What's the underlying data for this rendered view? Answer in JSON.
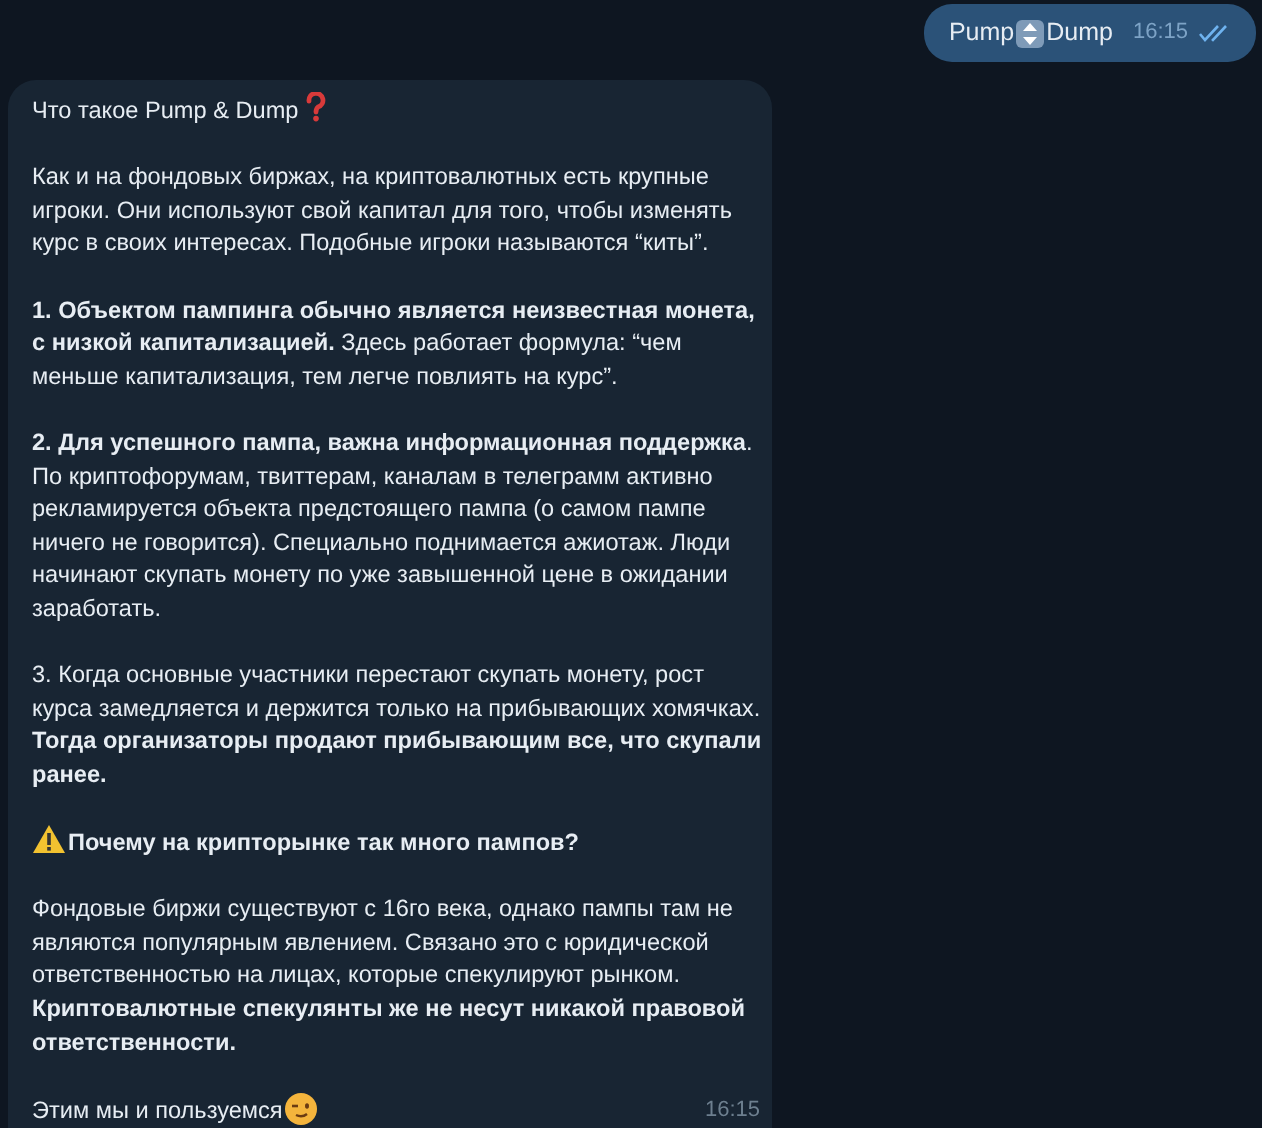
{
  "outgoing": {
    "parts": [
      "Pump",
      "Dump"
    ],
    "time": "16:15",
    "read": true
  },
  "incoming": {
    "time": "16:15",
    "paragraphs": [
      {
        "kind": "title",
        "text": "Что такое Pump & Dump"
      },
      {
        "kind": "plain",
        "text": "Как и на фондовых биржах, на криптовалютных есть крупные игроки. Они используют свой капитал для того, чтобы изменять курс в своих интересах. Подобные игроки называются “киты”."
      },
      {
        "kind": "plain",
        "text": "**1. Объектом пампинга обычно является неизвестная монета, с низкой капитализацией.** Здесь работает формула: “чем меньше капитализация, тем легче повлиять на курс”."
      },
      {
        "kind": "plain",
        "text": "**2. Для успешного пампа, важна информационная поддержка**. По криптофорумам, твиттерам, каналам в телеграмм активно рекламируется объекта предстоящего пампа (о самом пампе ничего не говорится). Специально поднимается ажиотаж. Люди начинают скупать монету по уже завышенной цене в ожидании заработать."
      },
      {
        "kind": "plain",
        "text": "3. Когда основные участники перестают скупать монету, рост курса замедляется и держится только на прибывающих хомячках. **Тогда организаторы продают прибывающим все, что скупали ранее.**"
      },
      {
        "kind": "heading",
        "text": "Почему на крипторынке так много пампов?"
      },
      {
        "kind": "plain",
        "text": "Фондовые биржи существуют с 16го века, однако пампы там не являются популярным явлением. Связано это с юридической ответственностью на лицах, которые спекулируют рынком. **Криптовалютные спекулянты же не несут никакой правовой ответственности.**"
      },
      {
        "kind": "closing",
        "text": "Этим мы и пользуемся"
      }
    ]
  }
}
